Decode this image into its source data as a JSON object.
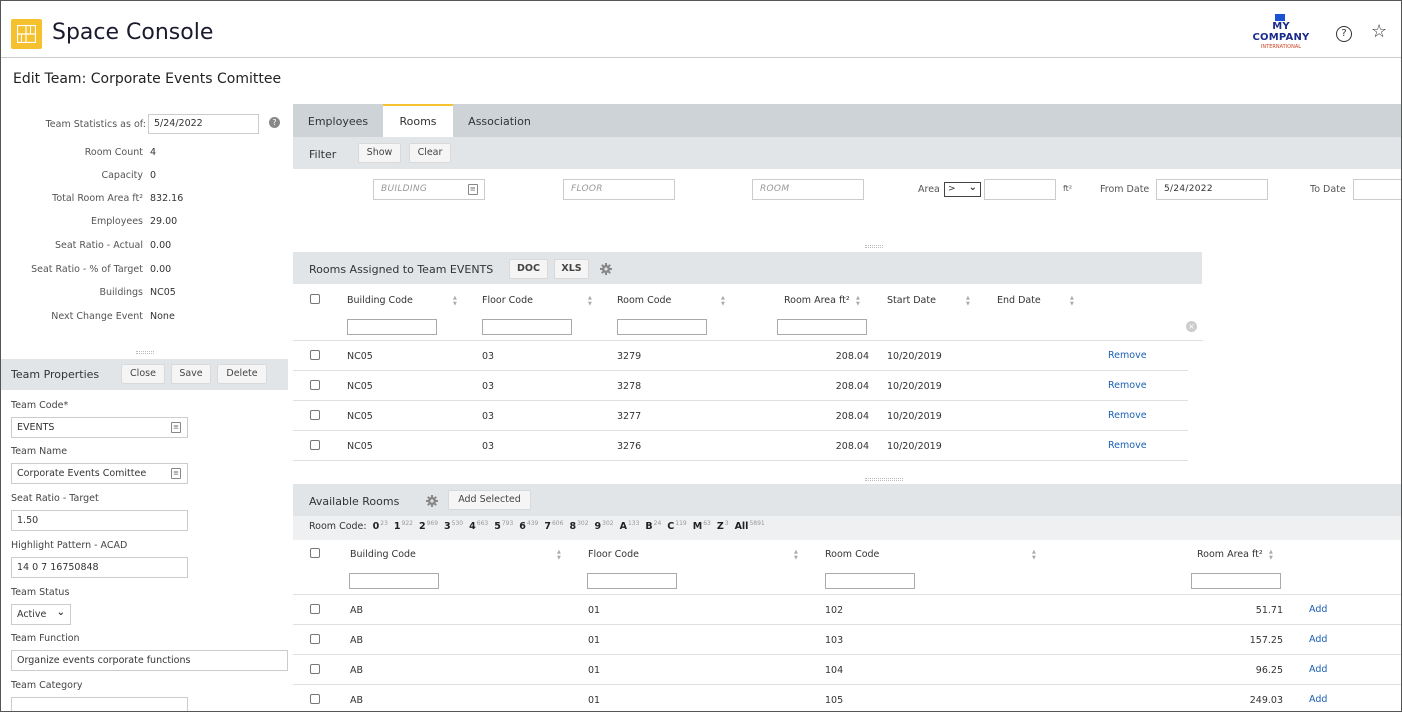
{
  "header": {
    "app_title": "Space Console",
    "company_name": "MY COMPANY",
    "company_sub": "INTERNATIONAL",
    "help_glyph": "?",
    "accent": "#f6c12e"
  },
  "page_title": "Edit Team: Corporate Events Comittee",
  "stats": {
    "as_of_label": "Team Statistics as of:",
    "as_of_value": "5/24/2022",
    "items": [
      {
        "label": "Room Count",
        "value": "4"
      },
      {
        "label": "Capacity",
        "value": "0"
      },
      {
        "label": "Total Room Area ft²",
        "value": "832.16"
      },
      {
        "label": "Employees",
        "value": "29.00"
      },
      {
        "label": "Seat Ratio - Actual",
        "value": "0.00"
      },
      {
        "label": "Seat Ratio - % of Target",
        "value": "0.00"
      },
      {
        "label": "Buildings",
        "value": "NC05"
      },
      {
        "label": "Next Change Event",
        "value": "None"
      }
    ]
  },
  "team_properties": {
    "title": "Team Properties",
    "close": "Close",
    "save": "Save",
    "delete": "Delete",
    "fields": {
      "team_code_label": "Team Code*",
      "team_code": "EVENTS",
      "team_name_label": "Team Name",
      "team_name": "Corporate Events Comittee",
      "seat_ratio_label": "Seat Ratio - Target",
      "seat_ratio": "1.50",
      "highlight_label": "Highlight Pattern - ACAD",
      "highlight": "14 0 7 16750848",
      "status_label": "Team Status",
      "status": "Active",
      "function_label": "Team Function",
      "function": "Organize events corporate functions",
      "category_label": "Team Category",
      "category": ""
    }
  },
  "tabs": [
    "Employees",
    "Rooms",
    "Association"
  ],
  "filter": {
    "label": "Filter",
    "show": "Show",
    "clear": "Clear",
    "building_ph": "BUILDING",
    "floor_ph": "FLOOR",
    "room_ph": "ROOM",
    "area_label": "Area",
    "area_op": ">",
    "area_unit": "ft²",
    "from_label": "From Date",
    "from_value": "5/24/2022",
    "to_label": "To Date"
  },
  "assigned": {
    "title": "Rooms Assigned to Team EVENTS",
    "doc": "DOC",
    "xls": "XLS",
    "headers": [
      "Building Code",
      "Floor Code",
      "Room Code",
      "Room Area ft²",
      "Start Date",
      "End Date"
    ],
    "action": "Remove",
    "rows": [
      {
        "building": "NC05",
        "floor": "03",
        "room": "3279",
        "area": "208.04",
        "start": "10/20/2019",
        "end": ""
      },
      {
        "building": "NC05",
        "floor": "03",
        "room": "3278",
        "area": "208.04",
        "start": "10/20/2019",
        "end": ""
      },
      {
        "building": "NC05",
        "floor": "03",
        "room": "3277",
        "area": "208.04",
        "start": "10/20/2019",
        "end": ""
      },
      {
        "building": "NC05",
        "floor": "03",
        "room": "3276",
        "area": "208.04",
        "start": "10/20/2019",
        "end": ""
      }
    ]
  },
  "available": {
    "title": "Available Rooms",
    "add_selected": "Add Selected",
    "room_code_label": "Room Code:",
    "room_codes": [
      {
        "code": "0",
        "count": "23"
      },
      {
        "code": "1",
        "count": "922"
      },
      {
        "code": "2",
        "count": "969"
      },
      {
        "code": "3",
        "count": "530"
      },
      {
        "code": "4",
        "count": "663"
      },
      {
        "code": "5",
        "count": "793"
      },
      {
        "code": "6",
        "count": "439"
      },
      {
        "code": "7",
        "count": "606"
      },
      {
        "code": "8",
        "count": "302"
      },
      {
        "code": "9",
        "count": "302"
      },
      {
        "code": "A",
        "count": "133"
      },
      {
        "code": "B",
        "count": "24"
      },
      {
        "code": "C",
        "count": "119"
      },
      {
        "code": "M",
        "count": "63"
      },
      {
        "code": "Z",
        "count": "3"
      },
      {
        "code": "All",
        "count": "5891"
      }
    ],
    "headers": [
      "Building Code",
      "Floor Code",
      "Room Code",
      "Room Area ft²"
    ],
    "action": "Add",
    "rows": [
      {
        "building": "AB",
        "floor": "01",
        "room": "102",
        "area": "51.71"
      },
      {
        "building": "AB",
        "floor": "01",
        "room": "103",
        "area": "157.25"
      },
      {
        "building": "AB",
        "floor": "01",
        "room": "104",
        "area": "96.25"
      },
      {
        "building": "AB",
        "floor": "01",
        "room": "105",
        "area": "249.03"
      }
    ]
  }
}
